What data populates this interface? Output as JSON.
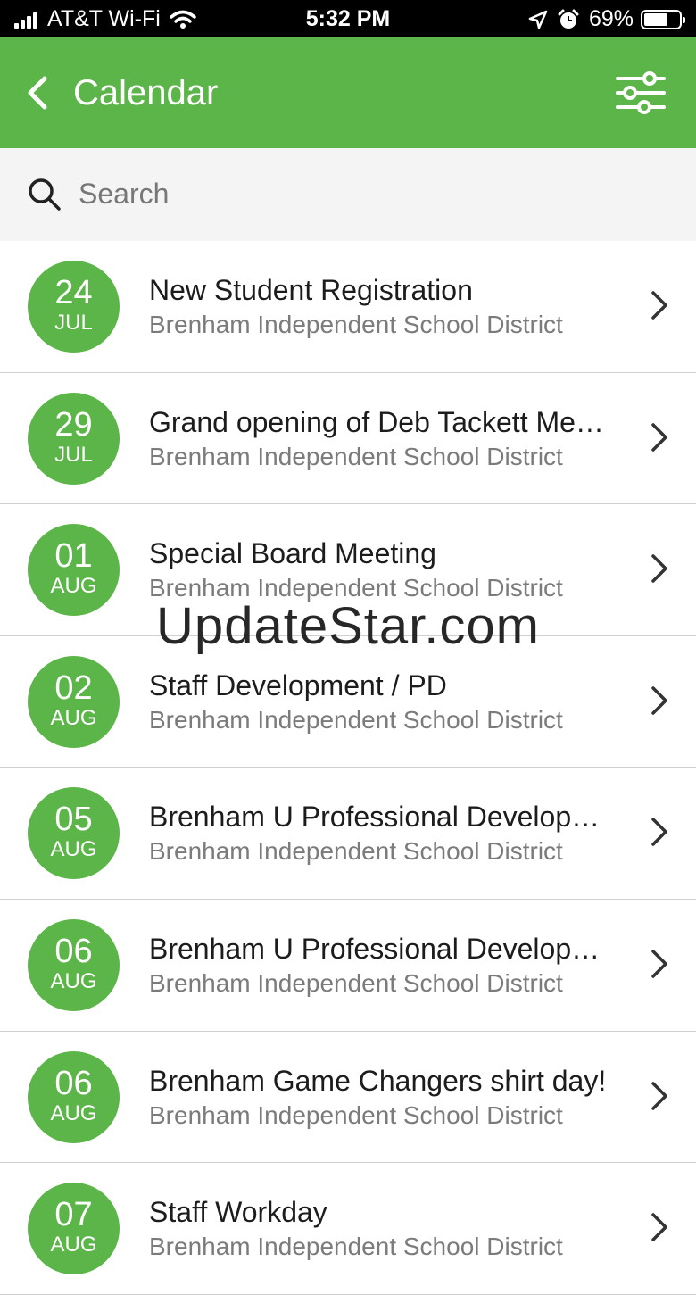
{
  "status_bar": {
    "carrier": "AT&T Wi-Fi",
    "time": "5:32 PM",
    "battery_percent": "69%",
    "battery_level": 0.69
  },
  "nav": {
    "title": "Calendar",
    "back_icon": "chevron-left-icon",
    "filter_icon": "sliders-icon",
    "color": "#5cb548"
  },
  "search": {
    "placeholder": "Search",
    "icon": "search-icon"
  },
  "events": [
    {
      "day": "24",
      "month": "JUL",
      "title": "New Student Registration",
      "subtitle": "Brenham Independent School District"
    },
    {
      "day": "29",
      "month": "JUL",
      "title": "Grand opening of Deb Tackett Me…",
      "subtitle": "Brenham Independent School District"
    },
    {
      "day": "01",
      "month": "AUG",
      "title": "Special Board Meeting",
      "subtitle": "Brenham Independent School District"
    },
    {
      "day": "02",
      "month": "AUG",
      "title": "Staff Development / PD",
      "subtitle": "Brenham Independent School District"
    },
    {
      "day": "05",
      "month": "AUG",
      "title": "Brenham U Professional Developm…",
      "subtitle": "Brenham Independent School District"
    },
    {
      "day": "06",
      "month": "AUG",
      "title": "Brenham U Professional Developm…",
      "subtitle": "Brenham Independent School District"
    },
    {
      "day": "06",
      "month": "AUG",
      "title": "Brenham Game Changers shirt day!",
      "subtitle": "Brenham Independent School District"
    },
    {
      "day": "07",
      "month": "AUG",
      "title": "Staff Workday",
      "subtitle": "Brenham Independent School District"
    }
  ],
  "watermark": "UpdateStar.com"
}
